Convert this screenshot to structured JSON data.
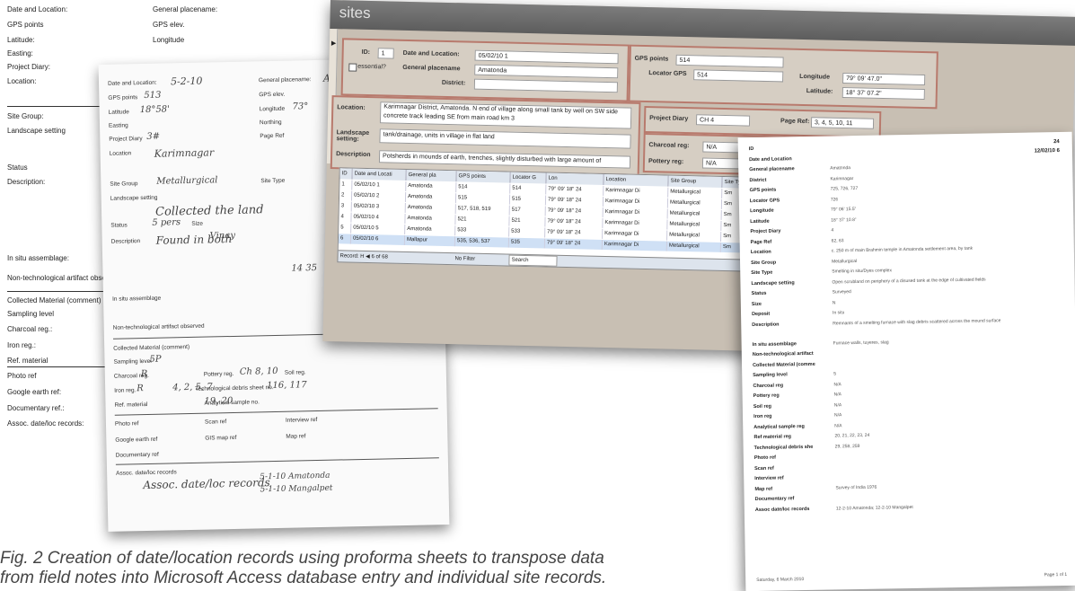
{
  "proforma": {
    "left_labels": [
      "Date and Location:",
      "GPS points",
      "Latitude:",
      "Easting:",
      "Project Diary:",
      "Location:",
      "Site Group:",
      "Landscape setting",
      "Status",
      "Description:",
      "In situ assemblage:",
      "Non-technological artifact observed:",
      "Collected Material (comment)",
      "Sampling level",
      "Charcoal reg.:",
      "Iron reg.:",
      "Ref. material",
      "Photo ref",
      "Google earth ref:",
      "Documentary ref.:",
      "Assoc. date/loc records:"
    ],
    "col2_labels": [
      "General placename:",
      "GPS elev.",
      "Longitude"
    ],
    "right_fragments": [
      "Su",
      "Po",
      "Te",
      "An",
      "Sc",
      "GIS"
    ]
  },
  "handsheet": {
    "labels": [
      "Date and Location:",
      "General placename:",
      "GPS points",
      "GPS elev.",
      "Latitude",
      "Longitude",
      "Easting",
      "Northing",
      "Project Diary",
      "Page Ref",
      "Location",
      "Site Group",
      "Site Type",
      "Landscape setting",
      "Status",
      "Size",
      "Description",
      "In situ assemblage",
      "Non-technological artifact observed",
      "Collected Material (comment)",
      "Sampling level",
      "Charcoal reg.",
      "Pottery reg.",
      "Soil reg.",
      "Iron reg.",
      "Technological debris sheet no.",
      "Ref. material",
      "Analytical sample no.",
      "Photo ref",
      "Scan ref",
      "Interview ref",
      "Google earth ref",
      "GIS map ref",
      "Map ref",
      "Documentary ref",
      "Assoc. date/loc records"
    ],
    "hand_values": [
      "5-2-10",
      "Amatonda",
      "513",
      "18°58'",
      "73°",
      "3#",
      "Karimnagar",
      "Metallurgical",
      "Collected the land",
      "5 pers",
      "Found in both",
      "14 35",
      "Vinay",
      "5P",
      "R",
      "Ch 8, 10",
      "R",
      "116, 117",
      "4, 2, 5, 7",
      "19, 20",
      "Assoc. date/loc records",
      "5-1-10 Amatonda",
      "5-1-10 Mangalpet"
    ]
  },
  "access": {
    "title": "sites",
    "labels": {
      "id": "ID:",
      "date_location": "Date and Location:",
      "essential": "essential?",
      "general_placename": "General placename",
      "district": "District:",
      "gps_points": "GPS points",
      "locator_gps": "Locator GPS",
      "longitude": "Longitude",
      "latitude": "Latitude:",
      "location": "Location:",
      "landscape": "Landscape setting:",
      "description": "Description",
      "project_diary": "Project Diary",
      "page_ref": "Page Ref:",
      "charcoal_reg": "Charcoal reg:",
      "pottery_reg": "Pottery reg:"
    },
    "values": {
      "id": "1",
      "date_location": "05/02/10 1",
      "general_placename": "Amatonda",
      "district": "",
      "gps_points": "514",
      "locator_gps": "514",
      "longitude": "79° 09' 47.0\"",
      "latitude": "18° 37' 07.2\"",
      "location": "Karimnagar District, Amatonda. N end of village along small tank by well on SW side concrete track leading SE from main road km 3",
      "landscape": "tank/drainage, units in village in flat land",
      "description": "Potsherds in mounds of earth, trenches, slightly disturbed with large amount of",
      "project_diary": "CH 4",
      "page_ref": "3, 4, 5, 10, 11",
      "charcoal_reg": "N/A",
      "pottery_reg": "N/A"
    },
    "grid": {
      "headers": [
        "ID",
        "Date and Locati",
        "General pla",
        "GPS points",
        "Locator G",
        "Lon",
        "Location",
        "Site Group",
        "Site Ty"
      ],
      "rows": [
        [
          "1",
          "05/02/10 1",
          "Amatonda",
          "514",
          "514",
          "79° 09' 18\" 24",
          "Karimnagar Di",
          "Metallurgical",
          "Sm"
        ],
        [
          "2",
          "05/02/10 2",
          "Amatonda",
          "515",
          "515",
          "79° 09' 18\" 24",
          "Karimnagar Di",
          "Metallurgical",
          "Sm"
        ],
        [
          "3",
          "05/02/10 3",
          "Amatonda",
          "517, 518, 519",
          "517",
          "79° 09' 18\" 24",
          "Karimnagar Di",
          "Metallurgical",
          "Sm"
        ],
        [
          "4",
          "05/02/10 4",
          "Amatonda",
          "521",
          "521",
          "79° 09' 18\" 24",
          "Karimnagar Di",
          "Metallurgical",
          "Sm"
        ],
        [
          "5",
          "05/02/10 5",
          "Amatonda",
          "533",
          "533",
          "79° 09' 18\" 24",
          "Karimnagar Di",
          "Metallurgical",
          "Sm"
        ],
        [
          "6",
          "05/02/10 6",
          "Mallapur",
          "535, 536, 537",
          "535",
          "79° 09' 18\" 24",
          "Karimnagar Di",
          "Metallurgical",
          "Sm"
        ]
      ],
      "nav_record": "Record: H ◀ 6 of 68",
      "nav_filter": "No Filter",
      "nav_search": "Search"
    }
  },
  "report": {
    "header_right_1": "24",
    "header_right_2": "12/02/10  6",
    "rows": [
      {
        "label": "ID",
        "value": ""
      },
      {
        "label": "Date and Location",
        "value": ""
      },
      {
        "label": "General placename",
        "value": "Amatonda"
      },
      {
        "label": "District",
        "value": "Karimnagar"
      },
      {
        "label": "GPS points",
        "value": "725, 726, 727"
      },
      {
        "label": "Locator GPS",
        "value": "726"
      },
      {
        "label": "Longitude",
        "value": "79° 06' 15.5\""
      },
      {
        "label": "Latitude",
        "value": "18° 37' 10.8\""
      },
      {
        "label": "Project Diary",
        "value": "4"
      },
      {
        "label": "Page Ref",
        "value": "62, 63"
      },
      {
        "label": "Location",
        "value": "c. 250 m of main Brahmin temple in Amatonda settlement area, by tank"
      },
      {
        "label": "Site Group",
        "value": "Metallurgical"
      },
      {
        "label": "Site Type",
        "value": "Smelting in situ/Dyes complex"
      },
      {
        "label": "Landscape setting",
        "value": "Open scrubland on periphery of a disused tank at the edge of cultivated fields"
      },
      {
        "label": "Status",
        "value": "Surveyed"
      },
      {
        "label": "Size",
        "value": "N"
      },
      {
        "label": "Deposit",
        "value": "In situ"
      },
      {
        "label": "Description",
        "value": "Remnants of a smelting furnace with slag debris scattered across the mound surface"
      },
      {
        "label": "In situ assemblage",
        "value": "Furnace walls, tuyeres, slag"
      },
      {
        "label": "Non-technological artifact",
        "value": ""
      },
      {
        "label": "Collected Material (comme",
        "value": ""
      },
      {
        "label": "Sampling level",
        "value": "5"
      },
      {
        "label": "Charcoal reg",
        "value": "N/A"
      },
      {
        "label": "Pottery reg",
        "value": "N/A"
      },
      {
        "label": "Soil reg",
        "value": "N/A"
      },
      {
        "label": "Iron reg",
        "value": "N/A"
      },
      {
        "label": "Analytical sample reg",
        "value": "N/A"
      },
      {
        "label": "Ref material reg",
        "value": "20, 21, 22, 23, 24"
      },
      {
        "label": "Technological debris she",
        "value": "29, 258, 259"
      },
      {
        "label": "Photo ref",
        "value": ""
      },
      {
        "label": "Scan ref",
        "value": ""
      },
      {
        "label": "Interview ref",
        "value": ""
      },
      {
        "label": "Map ref",
        "value": "Survey of India 1976"
      },
      {
        "label": "Documentary ref",
        "value": ""
      },
      {
        "label": "Assoc date/loc records",
        "value": "12-2-10 Amatonda; 12-2-10 Mangalpet"
      }
    ],
    "footer_left": "Saturday, 6 March 2010",
    "footer_right": "Page 1 of 1"
  },
  "caption": {
    "line1": "Fig. 2  Creation of date/location records using proforma sheets to transpose data",
    "line2": "from field notes into Microsoft Access database entry and individual site records."
  }
}
